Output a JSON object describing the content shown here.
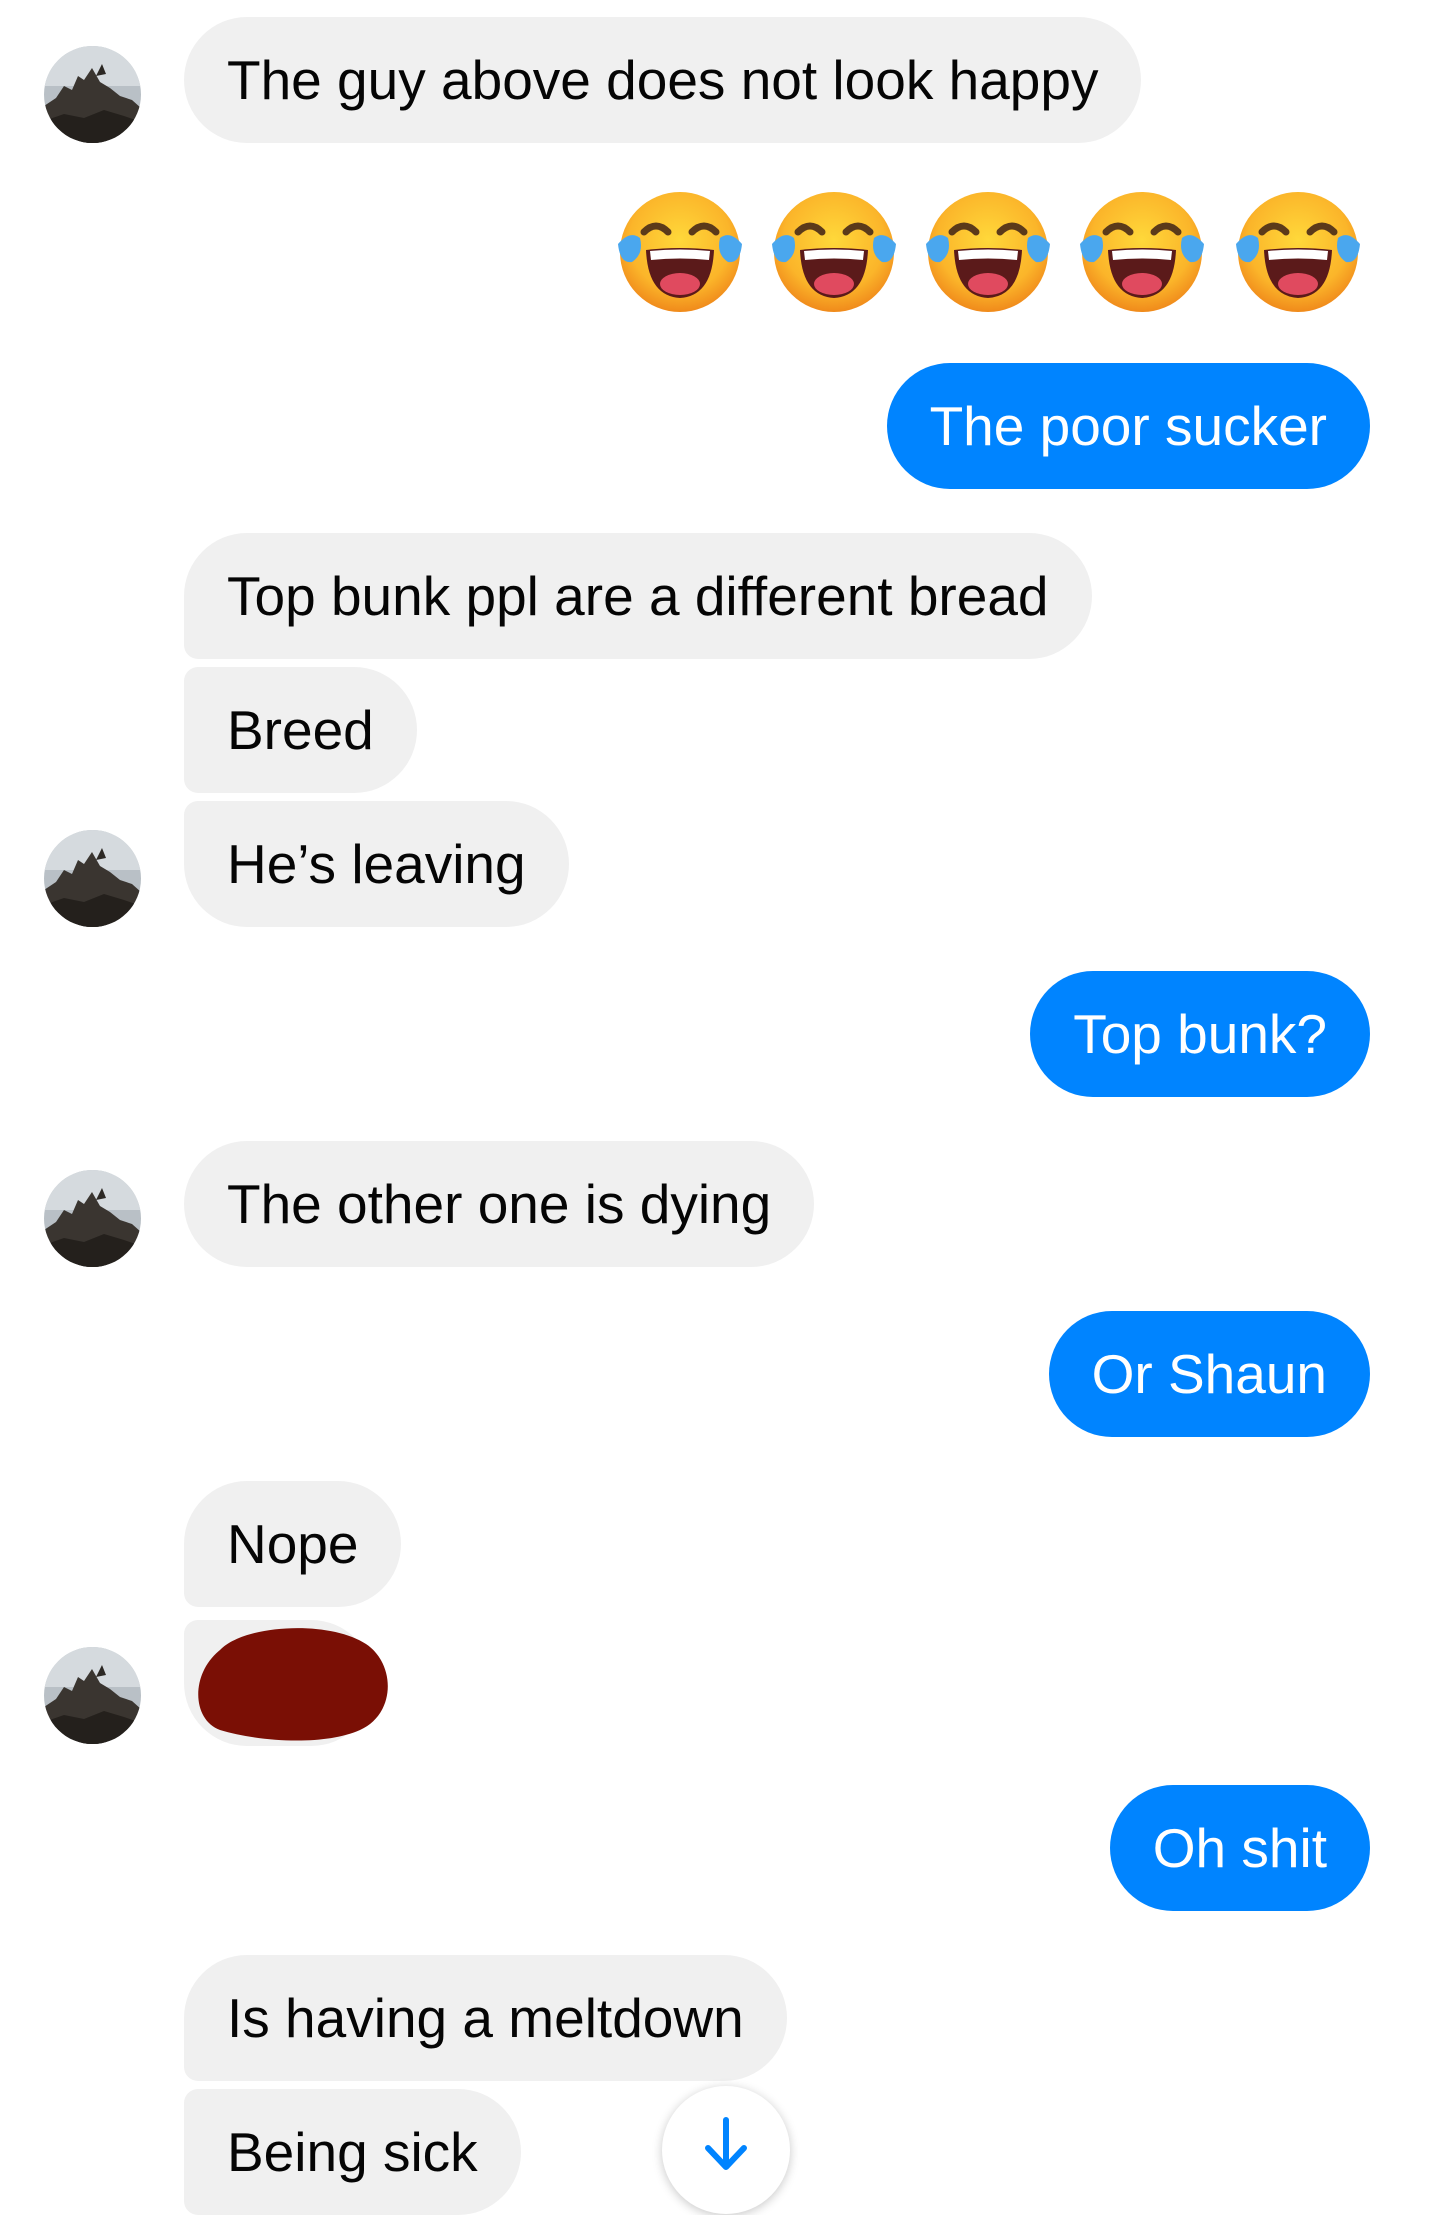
{
  "messages": [
    {
      "text": "The guy above does not look happy"
    },
    {
      "text": "The poor sucker"
    },
    {
      "text": "Top bunk ppl are a different bread"
    },
    {
      "text": "Breed"
    },
    {
      "text": "He’s leaving"
    },
    {
      "text": "Top bunk?"
    },
    {
      "text": "The other one is dying"
    },
    {
      "text": "Or Shaun"
    },
    {
      "text": "Nope"
    },
    {
      "text": "Oh shit"
    },
    {
      "text": "Is having a meltdown"
    },
    {
      "text": "Being sick"
    }
  ],
  "emoji_row": {
    "icon": "face-with-tears-of-joy-icon",
    "count": 5
  },
  "icons": {
    "avatar": "contact-avatar-photo",
    "scroll": "arrow-down-icon",
    "redaction": "red-scribble-redaction"
  },
  "colors": {
    "incoming_bubble": "#f0f0f0",
    "outgoing_bubble": "#0084ff",
    "incoming_text": "#050505",
    "outgoing_text": "#ffffff",
    "scroll_arrow": "#0084ff",
    "redaction": "#7a0f05"
  }
}
